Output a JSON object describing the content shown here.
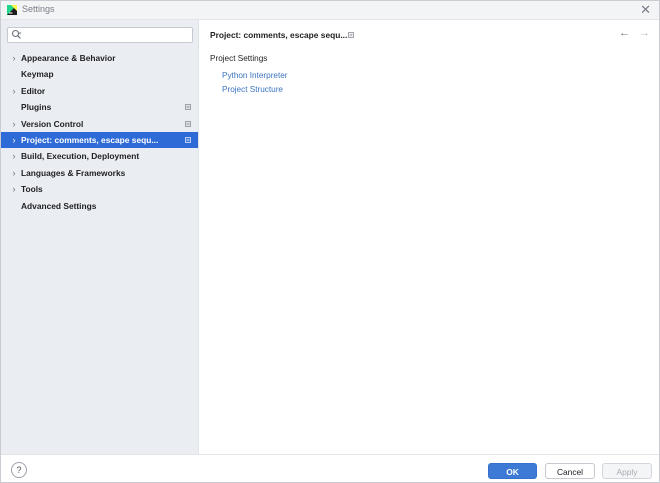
{
  "window": {
    "title": "Settings",
    "close_glyph": "✕"
  },
  "search": {
    "placeholder": "",
    "value": ""
  },
  "sidebar": {
    "items": [
      {
        "label": "Appearance & Behavior",
        "expandable": true,
        "badge": false,
        "selected": false
      },
      {
        "label": "Keymap",
        "expandable": false,
        "badge": false,
        "selected": false
      },
      {
        "label": "Editor",
        "expandable": true,
        "badge": false,
        "selected": false
      },
      {
        "label": "Plugins",
        "expandable": false,
        "badge": true,
        "selected": false
      },
      {
        "label": "Version Control",
        "expandable": true,
        "badge": true,
        "selected": false
      },
      {
        "label": "Project: comments, escape sequ...",
        "expandable": true,
        "badge": true,
        "selected": true
      },
      {
        "label": "Build, Execution, Deployment",
        "expandable": true,
        "badge": false,
        "selected": false
      },
      {
        "label": "Languages & Frameworks",
        "expandable": true,
        "badge": false,
        "selected": false
      },
      {
        "label": "Tools",
        "expandable": true,
        "badge": false,
        "selected": false
      },
      {
        "label": "Advanced Settings",
        "expandable": false,
        "badge": false,
        "selected": false
      }
    ]
  },
  "main": {
    "breadcrumb": "Project: comments, escape sequ...",
    "back_glyph": "←",
    "forward_glyph": "→",
    "section_title": "Project Settings",
    "links": [
      "Python Interpreter",
      "Project Structure"
    ]
  },
  "footer": {
    "help_label": "?",
    "ok_label": "OK",
    "cancel_label": "Cancel",
    "apply_label": "Apply"
  },
  "colors": {
    "accent": "#3d7ad6",
    "selection": "#2f6bd6",
    "link": "#3b73c0",
    "sidebar_bg": "#eaedf2"
  },
  "icons": {
    "app": "pycharm-app-icon",
    "search": "search-icon",
    "chevron": "chevron-right-icon",
    "badge": "project-level-settings-icon"
  }
}
